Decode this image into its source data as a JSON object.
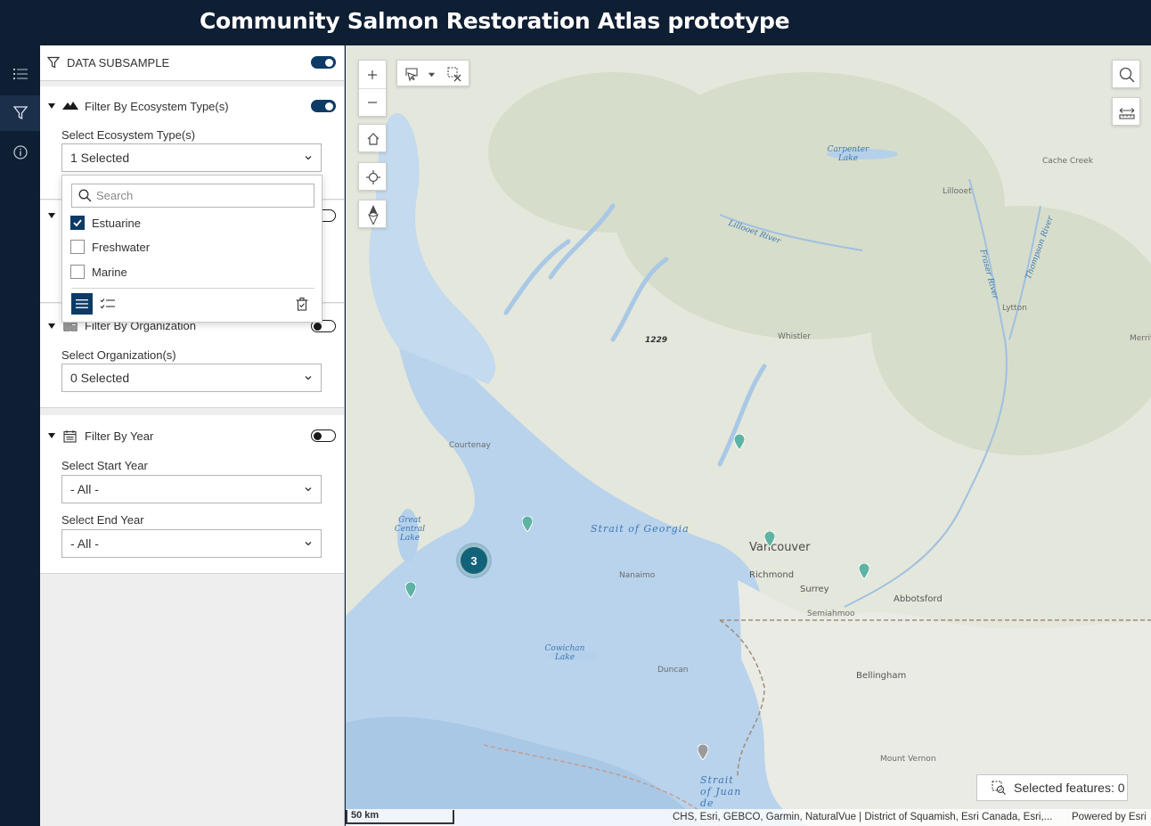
{
  "header": {
    "title": "Community Salmon Restoration Atlas prototype"
  },
  "rail": [
    {
      "icon": "list-icon"
    },
    {
      "icon": "filter-icon"
    },
    {
      "icon": "info-icon"
    }
  ],
  "panel": {
    "subsample": {
      "label": "DATA SUBSAMPLE",
      "enabled": true
    },
    "ecosystem": {
      "title": "Filter By Ecosystem Type(s)",
      "enabled": true,
      "select_label": "Select Ecosystem Type(s)",
      "select_value": "1 Selected"
    },
    "organization": {
      "title": "Filter By Organization",
      "enabled": false,
      "select_label": "Select Organization(s)",
      "select_value": "0 Selected"
    },
    "year": {
      "title": "Filter By Year",
      "enabled": false,
      "start_label": "Select Start Year",
      "start_value": "- All -",
      "end_label": "Select End Year",
      "end_value": "- All -"
    }
  },
  "dropdown": {
    "search_placeholder": "Search",
    "options": [
      {
        "label": "Estuarine",
        "checked": true
      },
      {
        "label": "Freshwater",
        "checked": false
      },
      {
        "label": "Marine",
        "checked": false
      }
    ]
  },
  "map": {
    "labels": {
      "strait_georgia": "Strait of Georgia",
      "strait_juan": "Strait of Juan de",
      "vancouver": "Vancouver",
      "richmond": "Richmond",
      "surrey": "Surrey",
      "semiahmoo": "Semiahmoo",
      "abbotsford": "Abbotsford",
      "bellingham": "Bellingham",
      "mount_vernon": "Mount Vernon",
      "nanaimo": "Nanaimo",
      "duncan": "Duncan",
      "courtenay": "Courtenay",
      "whistler": "Whistler",
      "lytton": "Lytton",
      "lillooet": "Lillooet",
      "cache_creek": "Cache Creek",
      "merritt": "Merrit",
      "carpenter_lake": "Carpenter Lake",
      "lillooet_river": "Lillooet River",
      "fraser_river": "Fraser River",
      "thompson_river": "Thompson River",
      "great_central_lake": "Great Central Lake",
      "cowichan_lake": "Cowichan Lake",
      "peak": "1229"
    },
    "cluster_count": "3",
    "selected_features": "Selected features: 0",
    "scale": "50 km",
    "credits": "CHS, Esri, GEBCO, Garmin, NaturalVue | District of Squamish, Esri Canada, Esri,...",
    "powered_by": "Powered by Esri",
    "colors": {
      "water": "#b5d0ea",
      "land": "#e3e6d8",
      "pin": "#5fb3a5",
      "cluster": "#12637a",
      "accent": "#0d3b66"
    }
  }
}
